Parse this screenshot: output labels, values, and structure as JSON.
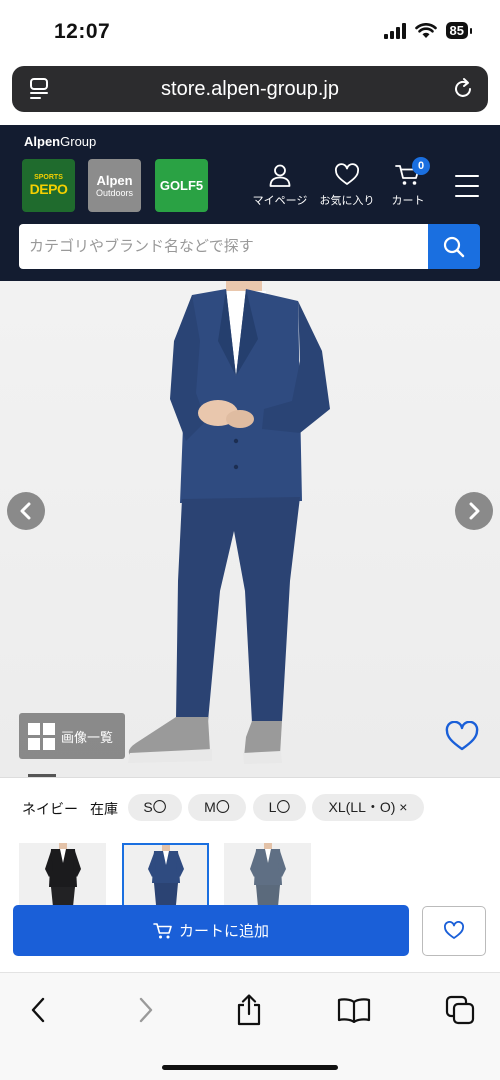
{
  "status_bar": {
    "time": "12:07",
    "battery": "85"
  },
  "browser": {
    "url": "store.alpen-group.jp"
  },
  "header": {
    "group_logo_bold": "Alpen",
    "group_logo_rest": "Group",
    "brand_tiles": [
      {
        "line1": "SPORTS",
        "line2": "DEPO",
        "color": "#1f6b2d"
      },
      {
        "line1": "Alpen",
        "line2": "Outdoors",
        "color": "#8c8c8c"
      },
      {
        "line1": "GOLF5",
        "line2": "",
        "color": "#2aa244"
      }
    ],
    "nav": {
      "mypage": "マイページ",
      "favorites": "お気に入り",
      "cart": "カート",
      "cart_count": "0"
    },
    "search": {
      "placeholder": "カテゴリやブランド名などで探す"
    }
  },
  "product": {
    "gallery_label": "画像一覧",
    "color": "ネイビー",
    "stock_label": "在庫",
    "sizes": [
      {
        "label": "S〇"
      },
      {
        "label": "M〇"
      },
      {
        "label": "L〇"
      },
      {
        "label": "XL(LL・O) ×"
      }
    ],
    "variants": [
      {
        "name": "black",
        "jacket": "#1b1b1d",
        "pants": "#222224"
      },
      {
        "name": "navy",
        "jacket": "#2f4b80",
        "pants": "#2b4373",
        "selected": true
      },
      {
        "name": "gray",
        "jacket": "#5f6f84",
        "pants": "#5b6a7c"
      }
    ],
    "add_to_cart": "カートに追加"
  },
  "colors": {
    "accent": "#1a6fe0",
    "header_bg": "#131c30"
  }
}
